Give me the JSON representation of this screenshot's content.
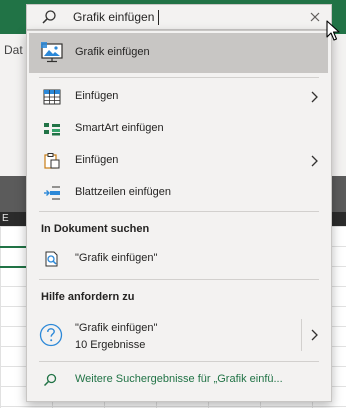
{
  "search": {
    "query": "Grafik einfügen",
    "placeholder": ""
  },
  "background": {
    "ribbon_tab_fragment": "Dat",
    "column_letter_fragment": "E"
  },
  "dropdown": {
    "top_result": {
      "label": "Grafik einfügen",
      "icon": "picture-monitor-icon"
    },
    "actions": [
      {
        "label": "Einfügen",
        "icon": "insert-table-icon",
        "has_submenu": true
      },
      {
        "label": "SmartArt einfügen",
        "icon": "smartart-icon",
        "has_submenu": false
      },
      {
        "label": "Einfügen",
        "icon": "paste-clipboard-icon",
        "has_submenu": true
      },
      {
        "label": "Blattzeilen einfügen",
        "icon": "insert-rows-icon",
        "has_submenu": false
      }
    ],
    "document_section": {
      "heading": "In Dokument suchen",
      "item": {
        "label": "\"Grafik einfügen\"",
        "icon": "document-search-icon"
      }
    },
    "help_section": {
      "heading": "Hilfe anfordern zu",
      "item": {
        "label": "\"Grafik einfügen\"",
        "sublabel": "10 Ergebnisse",
        "icon": "help-question-icon",
        "has_submenu": true
      }
    },
    "more_results": {
      "label": "Weitere Suchergebnisse für „Grafik einfü...",
      "icon": "search-icon"
    }
  },
  "colors": {
    "accent_green": "#217346",
    "dropdown_bg": "#f3f2f1",
    "highlight": "#c8c6c4",
    "text": "#252423"
  }
}
